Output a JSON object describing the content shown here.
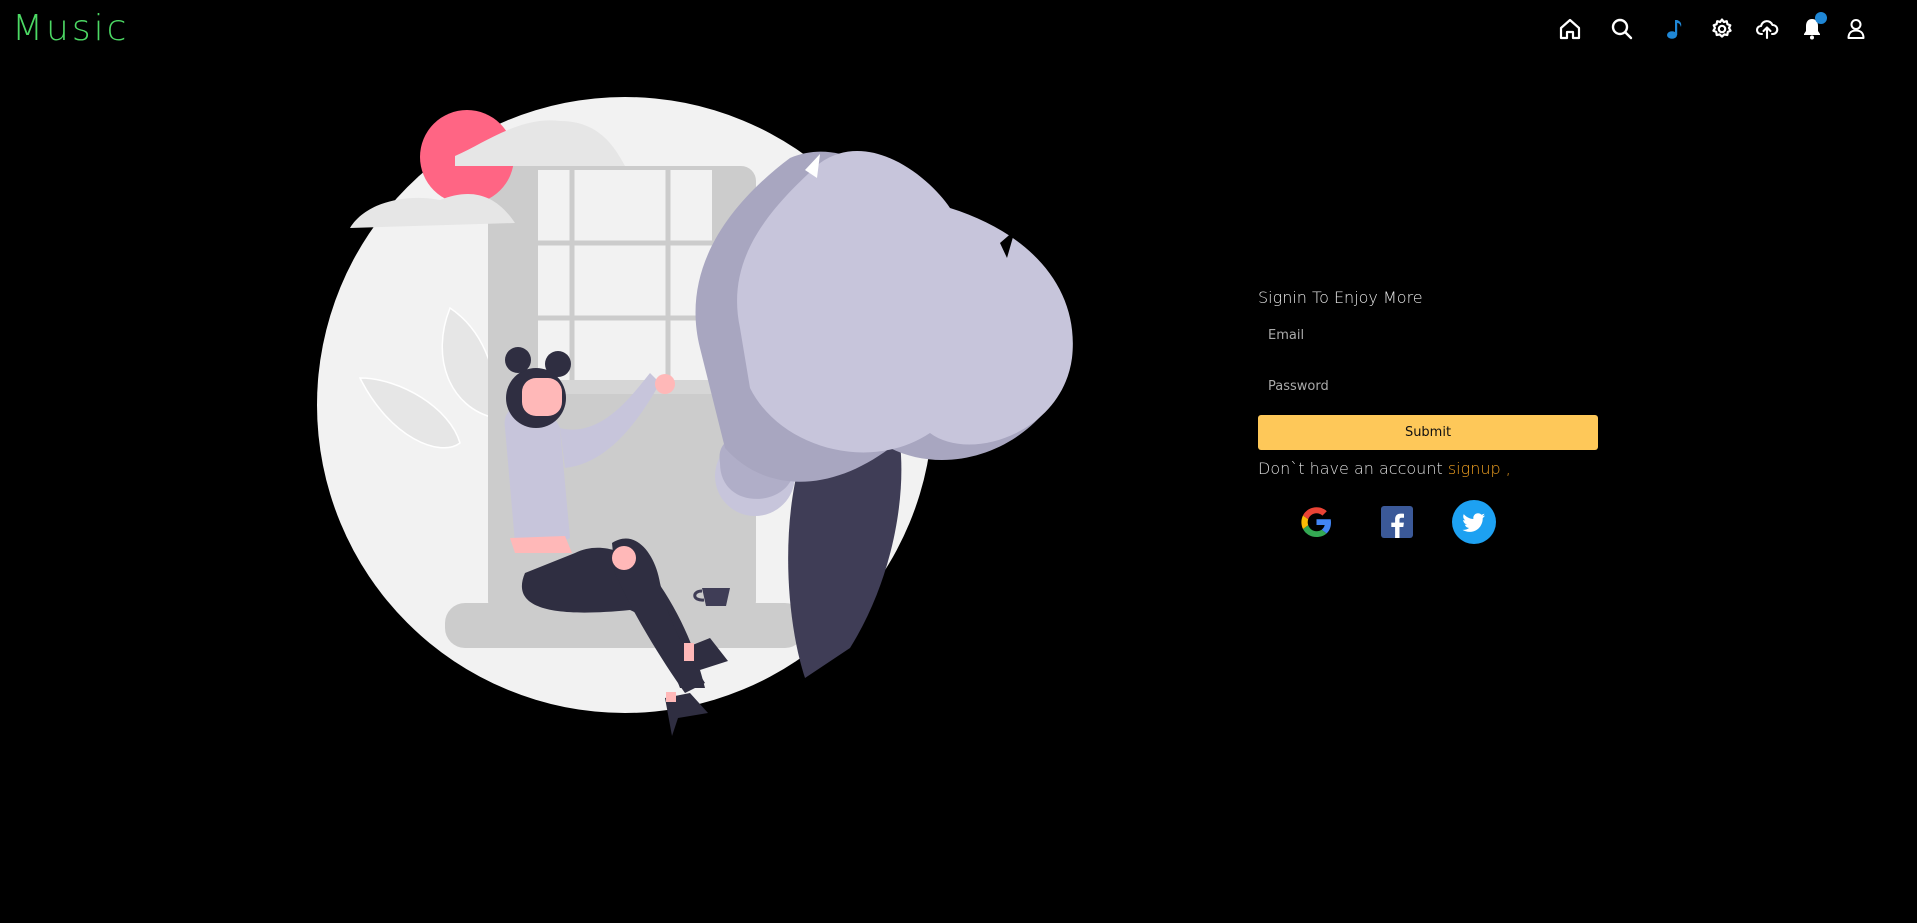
{
  "app": {
    "title": "Music"
  },
  "nav": {
    "items": [
      {
        "name": "home",
        "icon": "home-icon"
      },
      {
        "name": "search",
        "icon": "search-icon"
      },
      {
        "name": "music",
        "icon": "music-note-icon",
        "color": "#1f87d6"
      },
      {
        "name": "settings",
        "icon": "gear-icon"
      },
      {
        "name": "upload",
        "icon": "cloud-upload-icon"
      },
      {
        "name": "notifications",
        "icon": "bell-icon",
        "badge_color": "#1f87d6"
      },
      {
        "name": "profile",
        "icon": "user-icon"
      }
    ]
  },
  "signin": {
    "title": "Signin To Enjoy More",
    "email_placeholder": "Email",
    "password_placeholder": "Password",
    "submit_label": "Submit",
    "no_account_text": "Don`t have an account",
    "signup_link": "signup",
    "trailing": " ,",
    "submit_color": "#fec859",
    "link_color": "#f0a020"
  },
  "social": [
    {
      "name": "google",
      "icon": "google-icon"
    },
    {
      "name": "facebook",
      "icon": "facebook-icon",
      "color": "#3b5998"
    },
    {
      "name": "twitter",
      "icon": "twitter-icon",
      "color": "#1da1f2"
    }
  ],
  "colors": {
    "logo": "#4cd964",
    "background": "#000000"
  }
}
